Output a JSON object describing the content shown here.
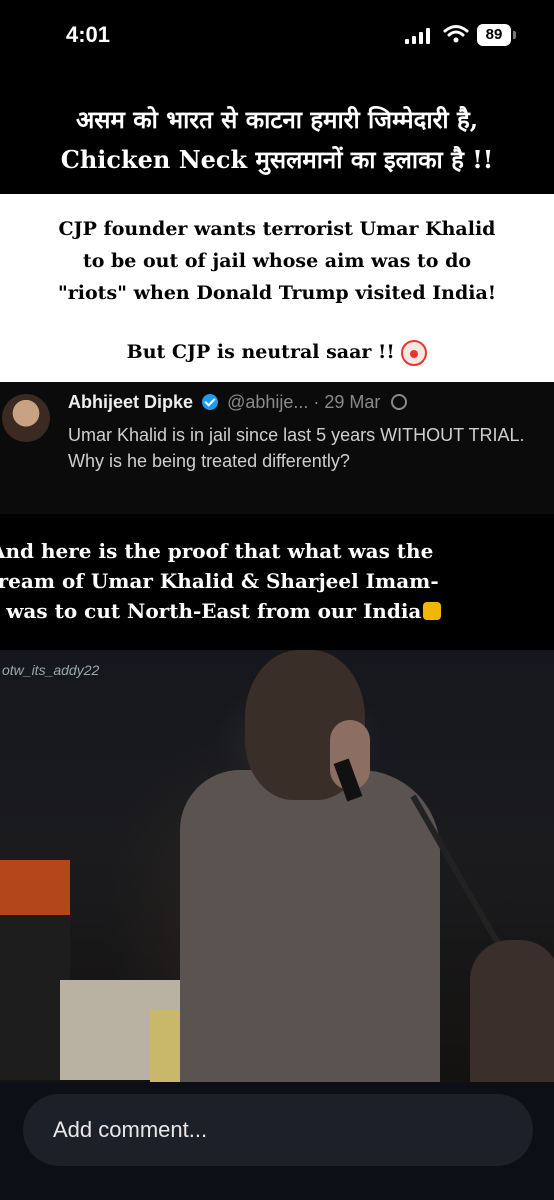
{
  "status_bar": {
    "time": "4:01",
    "battery": "89",
    "icons": [
      "cellular-signal-icon",
      "wifi-icon",
      "battery-icon"
    ]
  },
  "header": {
    "hindi_line1": "असम को भारत से काटना हमारी जिम्मेदारी है,",
    "hindi_line2_bold": "Chicken Neck",
    "hindi_line2_rest": "मुसलमानों का इलाका है !!"
  },
  "card": {
    "line1": "CJP founder wants terrorist Umar Khalid",
    "line2": "to be out of jail whose  aim was to do",
    "line3": "\"riots\" when Donald Trump visited India!",
    "footer": "But CJP is neutral saar !!",
    "footer_icon": "clown-face-icon"
  },
  "tweet": {
    "name": "Abhijeet Dipke",
    "handle": "@abhije...",
    "date": "· 29 Mar",
    "text": "Umar Khalid is in jail since last 5 years WITHOUT TRIAL. Why is he being treated differently?"
  },
  "proof": {
    "line1": "And here is the proof that what was the",
    "line2": "lream of Umar Khalid & Sharjeel Imam-",
    "line3": "t was to cut North-East from our India",
    "icon": "pointing-down-hand-icon"
  },
  "video": {
    "watermark": "otw_its_addy22"
  },
  "comment": {
    "placeholder": "Add comment..."
  }
}
